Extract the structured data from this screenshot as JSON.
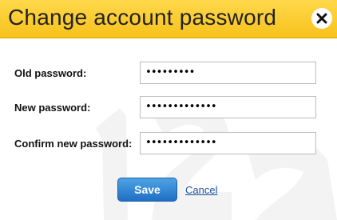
{
  "dialog": {
    "title": "Change account password",
    "close_icon": "close-icon"
  },
  "form": {
    "old_password": {
      "label": "Old password:",
      "value": "•••••••••"
    },
    "new_password": {
      "label": "New password:",
      "value": "•••••••••••••"
    },
    "confirm_password": {
      "label": "Confirm new password:",
      "value": "•••••••••••••"
    }
  },
  "actions": {
    "save_label": "Save",
    "cancel_label": "Cancel"
  },
  "colors": {
    "header": "#f7c21c",
    "save_button": "#2a7fd4",
    "link": "#1d4fa3"
  }
}
